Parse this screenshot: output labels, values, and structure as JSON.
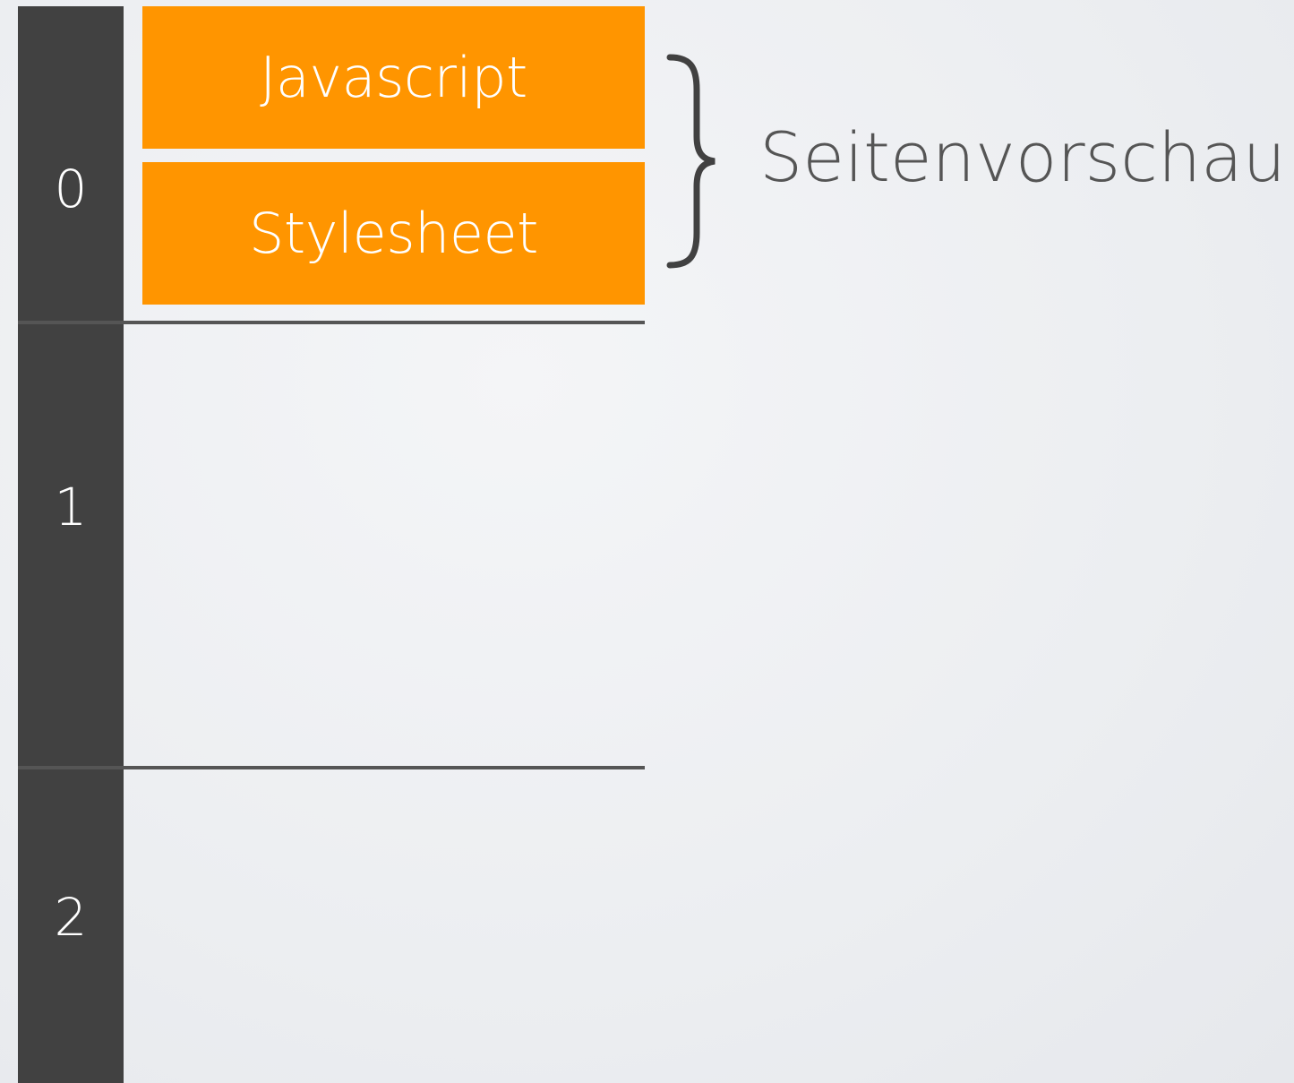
{
  "timeline": {
    "ticks": [
      "0",
      "1",
      "2"
    ]
  },
  "blocks": [
    {
      "label": "Javascript"
    },
    {
      "label": "Stylesheet"
    }
  ],
  "group": {
    "label": "Seitenvorschau"
  },
  "colors": {
    "timeline": "#414141",
    "block": "#ff9500",
    "divider": "#555555",
    "label": "#555555",
    "background": "#eceef1"
  }
}
